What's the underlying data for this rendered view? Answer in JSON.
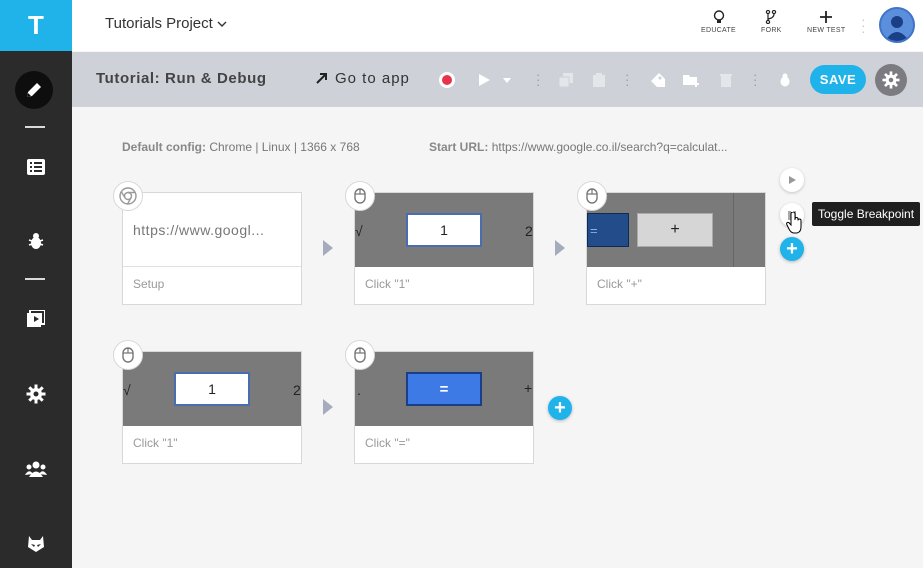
{
  "app": {
    "logo_letter": "T"
  },
  "sidebar": {
    "items": [
      {
        "icon": "pencil-icon",
        "active": true
      },
      {
        "icon": "list-icon"
      },
      {
        "icon": "bug-icon"
      },
      {
        "icon": "play-folder-icon"
      },
      {
        "icon": "gear-icon"
      },
      {
        "icon": "team-icon"
      },
      {
        "icon": "mask-icon"
      }
    ]
  },
  "header": {
    "project_name": "Tutorials Project",
    "actions": [
      {
        "label": "EDUCATE",
        "icon": "lightbulb-icon"
      },
      {
        "label": "FORK",
        "icon": "fork-icon"
      },
      {
        "label": "NEW TEST",
        "icon": "plus-icon"
      }
    ]
  },
  "toolbar": {
    "title": "Tutorial: Run & Debug",
    "goto_label": "Go to app",
    "save_label": "SAVE"
  },
  "config": {
    "default_label": "Default config:",
    "default_value": "Chrome | Linux | 1366 x 768",
    "start_label": "Start URL:",
    "start_value": "https://www.google.co.il/search?q=calculat..."
  },
  "steps": [
    {
      "caption": "Setup",
      "thumb_text": "https://www.googl...",
      "icon": "chrome-icon"
    },
    {
      "caption": "Click \"1\"",
      "key": "1",
      "left": "√",
      "right": "2",
      "icon": "mouse-icon"
    },
    {
      "caption": "Click \"+\"",
      "key": "+",
      "left": "=",
      "icon": "mouse-icon"
    },
    {
      "caption": "Click \"1\"",
      "key": "1",
      "left": "√",
      "right": "2",
      "icon": "mouse-icon"
    },
    {
      "caption": "Click \"=\"",
      "key": "=",
      "left": ".",
      "right": "+",
      "icon": "mouse-icon"
    }
  ],
  "tooltip": {
    "text": "Toggle Breakpoint"
  },
  "colors": {
    "accent": "#1fb3ea",
    "sidebar": "#2b2b2b",
    "toolbar": "#cfd1d9",
    "record": "#e8344a"
  }
}
